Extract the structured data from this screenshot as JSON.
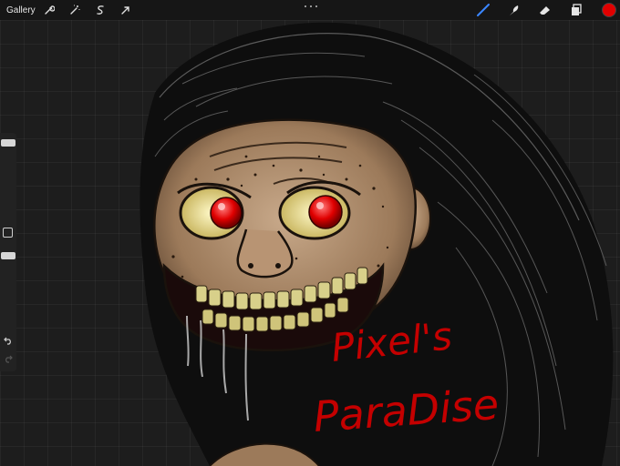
{
  "toolbar": {
    "gallery_label": "Gallery",
    "left_icons": [
      "wrench-icon",
      "magic-wand-icon",
      "selection-icon",
      "transform-arrow-icon"
    ],
    "right_icons": [
      "brush-icon",
      "smudge-icon",
      "eraser-icon",
      "layers-icon"
    ],
    "active_tool": "brush",
    "accent_color": "#3a86ff",
    "current_color": "#e00000"
  },
  "canvas": {
    "handwritten_text": [
      "Pixel's",
      "ParaDise"
    ]
  },
  "sidebar": {
    "brush_size_level": 0.96,
    "opacity_level": 0.96
  }
}
